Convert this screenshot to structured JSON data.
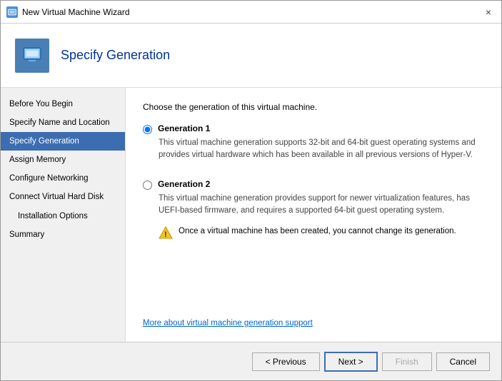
{
  "window": {
    "title": "New Virtual Machine Wizard",
    "close_label": "×"
  },
  "header": {
    "title": "Specify Generation"
  },
  "sidebar": {
    "items": [
      {
        "id": "before-you-begin",
        "label": "Before You Begin",
        "active": false,
        "sub": false
      },
      {
        "id": "specify-name",
        "label": "Specify Name and Location",
        "active": false,
        "sub": false
      },
      {
        "id": "specify-generation",
        "label": "Specify Generation",
        "active": true,
        "sub": false
      },
      {
        "id": "assign-memory",
        "label": "Assign Memory",
        "active": false,
        "sub": false
      },
      {
        "id": "configure-networking",
        "label": "Configure Networking",
        "active": false,
        "sub": false
      },
      {
        "id": "connect-virtual-hard-disk",
        "label": "Connect Virtual Hard Disk",
        "active": false,
        "sub": false
      },
      {
        "id": "installation-options",
        "label": "Installation Options",
        "active": false,
        "sub": true
      },
      {
        "id": "summary",
        "label": "Summary",
        "active": false,
        "sub": false
      }
    ]
  },
  "main": {
    "instruction": "Choose the generation of this virtual machine.",
    "generation1": {
      "label": "Generation 1",
      "description": "This virtual machine generation supports 32-bit and 64-bit guest operating systems and provides virtual hardware which has been available in all previous versions of Hyper-V."
    },
    "generation2": {
      "label": "Generation 2",
      "description": "This virtual machine generation provides support for newer virtualization features, has UEFI-based firmware, and requires a supported 64-bit guest operating system."
    },
    "warning": "Once a virtual machine has been created, you cannot change its generation.",
    "link": "More about virtual machine generation support"
  },
  "footer": {
    "previous_label": "< Previous",
    "next_label": "Next >",
    "finish_label": "Finish",
    "cancel_label": "Cancel"
  }
}
